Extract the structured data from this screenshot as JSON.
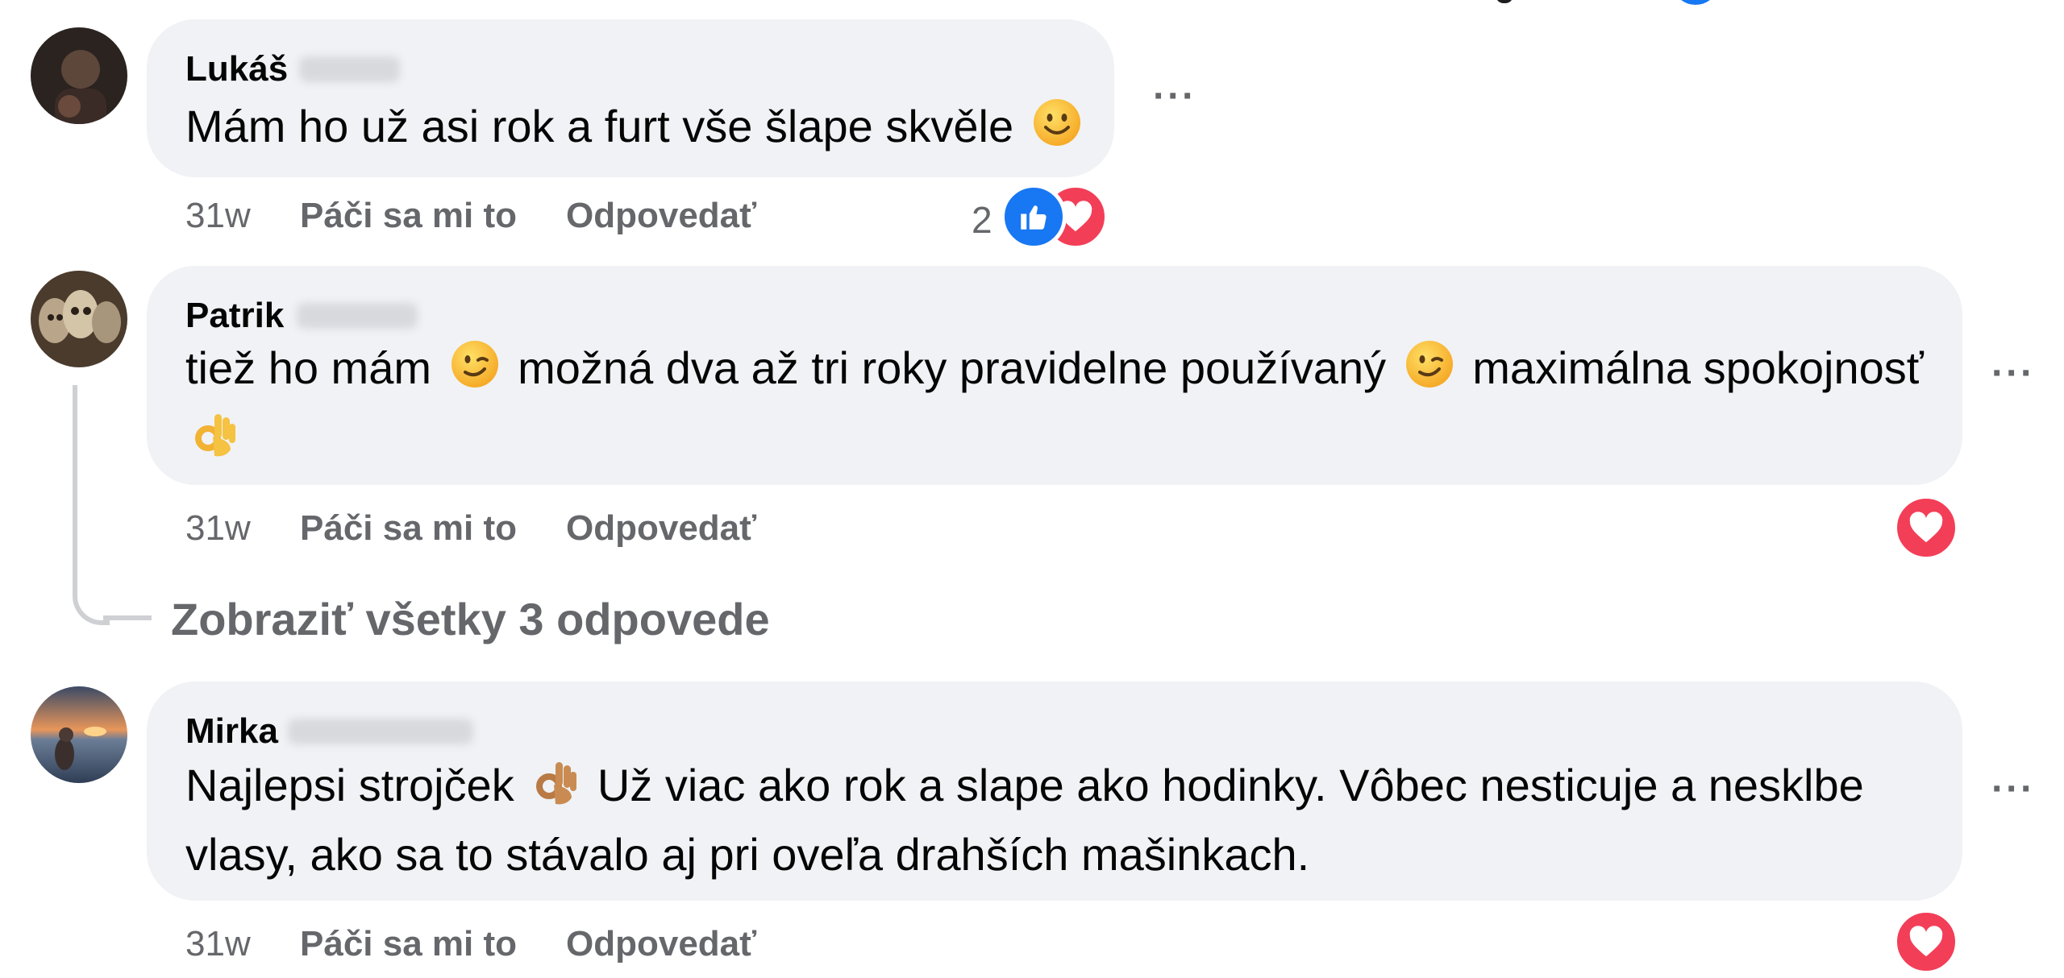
{
  "comments": [
    {
      "author": "Lukáš",
      "text": "Mám ho už asi rok a furt vše šlape skvěle",
      "time": "31w",
      "like_label": "Páči sa mi to",
      "reply_label": "Odpovedať",
      "reaction_count": "2",
      "emojis": [
        "slightly-smiling-face-emoji"
      ],
      "reactions": [
        "like-reaction-icon",
        "love-reaction-icon"
      ]
    },
    {
      "author": "Patrik",
      "text_part1": "tiež ho mám",
      "text_part2": "možná dva až tri roky pravidelne používaný",
      "text_part3": "maximálna spokojnosť",
      "time": "31w",
      "like_label": "Páči sa mi to",
      "reply_label": "Odpovedať",
      "emojis": [
        "winking-face-emoji",
        "winking-face-emoji",
        "ok-hand-emoji"
      ],
      "reactions": [
        "love-reaction-icon"
      ]
    },
    {
      "author": "Mirka",
      "text_part1": "Najlepsi strojček",
      "text_part2": "Už viac ako rok a slape ako hodinky. Vôbec nesticuje a nesklbe vlasy, ako sa to stávalo aj pri oveľa drahších mašinkach.",
      "time": "31w",
      "like_label": "Páči sa mi to",
      "reply_label": "Odpovedať",
      "emojis": [
        "ok-hand-emoji"
      ],
      "reactions": [
        "love-reaction-icon"
      ]
    }
  ],
  "view_replies_label": "Zobraziť všetky 3 odpovede",
  "more_label": "···",
  "colors": {
    "bubble": "#f0f2f5",
    "secondary_text": "#65676b",
    "like_blue": "#1877f2",
    "love_red": "#f33e58"
  }
}
